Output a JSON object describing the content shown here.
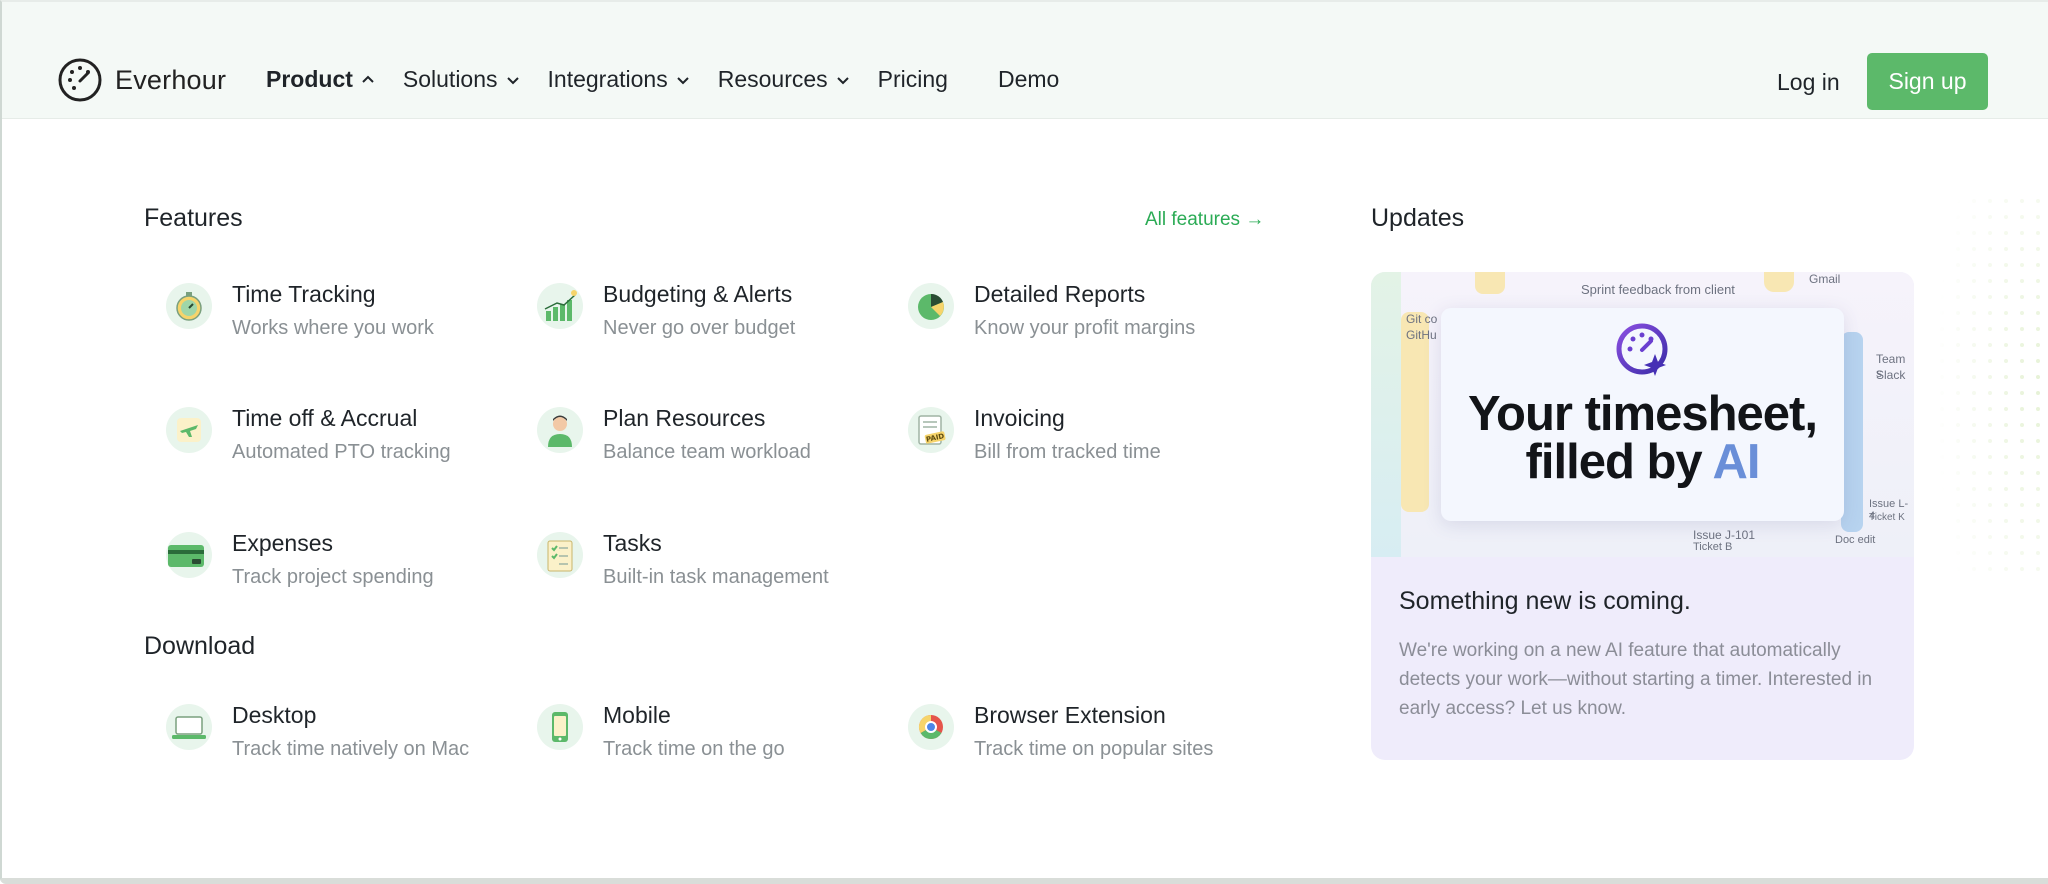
{
  "brand": {
    "name": "Everhour"
  },
  "nav": {
    "items": [
      {
        "label": "Product"
      },
      {
        "label": "Solutions"
      },
      {
        "label": "Integrations"
      },
      {
        "label": "Resources"
      },
      {
        "label": "Pricing"
      },
      {
        "label": "Demo"
      }
    ],
    "login": "Log in",
    "signup": "Sign up"
  },
  "features": {
    "title": "Features",
    "all_link": "All features →",
    "items": [
      {
        "title": "Time Tracking",
        "sub": "Works where you work",
        "icon": "stopwatch-icon"
      },
      {
        "title": "Budgeting & Alerts",
        "sub": "Never go over budget",
        "icon": "chart-growth-icon"
      },
      {
        "title": "Detailed Reports",
        "sub": "Know your profit margins",
        "icon": "pie-chart-icon"
      },
      {
        "title": "Time off & Accrual",
        "sub": "Automated PTO tracking",
        "icon": "airplane-icon"
      },
      {
        "title": "Plan Resources",
        "sub": "Balance team workload",
        "icon": "person-icon"
      },
      {
        "title": "Invoicing",
        "sub": "Bill from tracked time",
        "icon": "paid-invoice-icon"
      },
      {
        "title": "Expenses",
        "sub": "Track project spending",
        "icon": "credit-card-icon"
      },
      {
        "title": "Tasks",
        "sub": "Built-in task management",
        "icon": "task-list-icon"
      }
    ]
  },
  "download": {
    "title": "Download",
    "items": [
      {
        "title": "Desktop",
        "sub": "Track time natively on Mac",
        "icon": "laptop-icon"
      },
      {
        "title": "Mobile",
        "sub": "Track time on the go",
        "icon": "phone-icon"
      },
      {
        "title": "Browser Extension",
        "sub": "Track time on popular sites",
        "icon": "chrome-icon"
      }
    ]
  },
  "updates": {
    "title": "Updates",
    "headline_line1": "Your timesheet,",
    "headline_line2_a": "filled by ",
    "headline_line2_b": "AI",
    "card_title": "Something new is coming.",
    "card_text": "We're working on a new AI feature that automatically detects your work—without starting a timer. Interested in early access? Let us know.",
    "collage": {
      "c1": "Sprint feedback from client",
      "c2": "Gmail",
      "c3": "Git co",
      "c4": "GitHu",
      "c5": "Team s",
      "c6": "Slack",
      "c7": "Issue J-101",
      "c8": "Ticket B",
      "c9": "Doc edit",
      "c10": "Issue L-4",
      "c11": "Ticket K"
    }
  },
  "colors": {
    "accent": "#5cb96a",
    "link": "#2bab55",
    "card_bg": "#efecfb"
  }
}
